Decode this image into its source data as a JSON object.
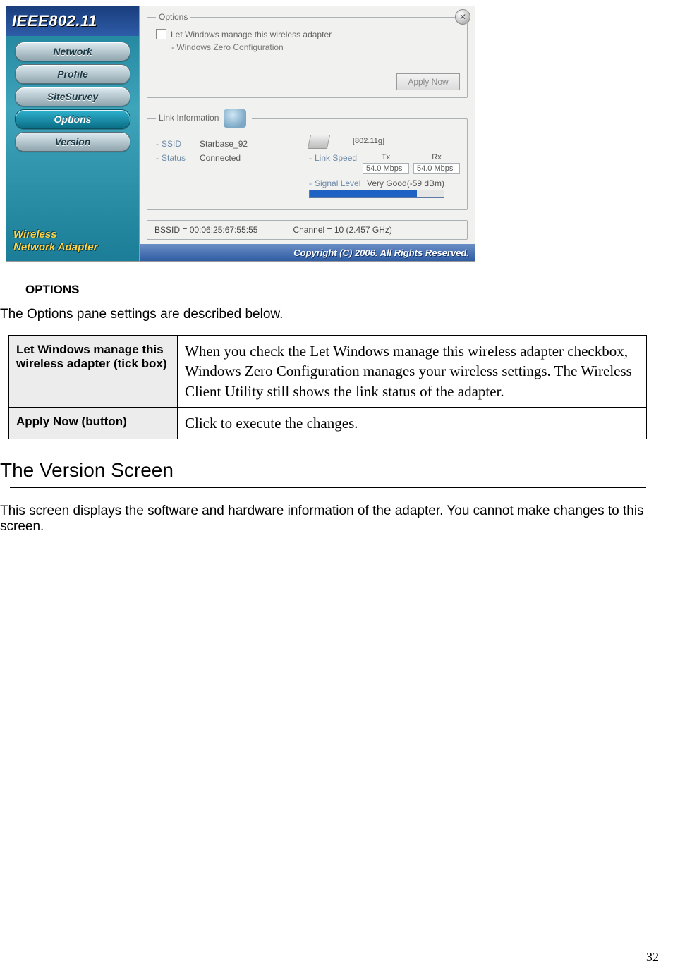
{
  "screenshot": {
    "brand": "IEEE802.11",
    "close_label": "✕",
    "nav": {
      "network": "Network",
      "profile": "Profile",
      "sitesurvey": "SiteSurvey",
      "options": "Options",
      "version": "Version"
    },
    "adapter_label_line1": "Wireless",
    "adapter_label_line2": "Network Adapter",
    "options_panel": {
      "legend": "Options",
      "checkbox_label": "Let Windows manage this wireless adapter",
      "sub_line": "- Windows Zero Configuration",
      "apply_btn": "Apply Now"
    },
    "link_panel": {
      "legend": "Link Information",
      "ssid_label": "SSID",
      "ssid_value": "Starbase_92",
      "status_label": "Status",
      "status_value": "Connected",
      "mode": "[802.11g]",
      "link_speed_label": "Link Speed",
      "tx_label": "Tx",
      "rx_label": "Rx",
      "tx_value": "54.0 Mbps",
      "rx_value": "54.0 Mbps",
      "signal_label": "Signal Level",
      "signal_value": "Very Good(-59 dBm)"
    },
    "info_strip": {
      "bssid": "BSSID = 00:06:25:67:55:55",
      "channel": "Channel = 10 (2.457 GHz)"
    },
    "copyright": "Copyright (C) 2006. All Rights Reserved."
  },
  "doc": {
    "options_heading": "OPTIONS",
    "options_intro": "The Options pane settings are described below.",
    "table": {
      "row1_label": "Let Windows manage this wireless adapter (tick box)",
      "row1_value": "When you check the Let Windows manage this wireless adapter checkbox, Windows Zero Configuration manages your wireless settings. The Wireless Client Utility still shows the link status of the adapter.",
      "row2_label": "Apply Now (button)",
      "row2_value": "Click to execute the changes."
    },
    "version_heading": "The Version Screen",
    "version_body": "This screen displays the software and hardware information of the adapter. You cannot make changes to this screen.",
    "page_number": "32"
  }
}
